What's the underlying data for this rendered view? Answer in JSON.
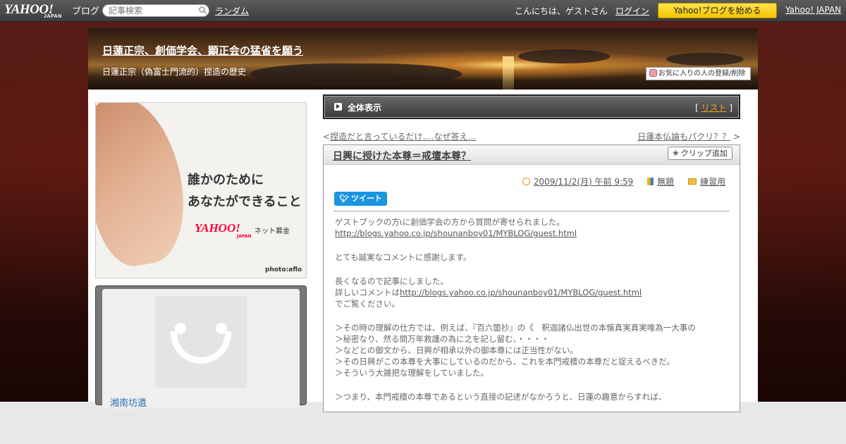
{
  "topbar": {
    "logo_main": "YAHOO!",
    "logo_sub": "JAPAN",
    "logo_blog": "ブログ",
    "search_placeholder": "記事検索",
    "random_label": "ランダム",
    "greeting": "こんにちは、ゲストさん",
    "login_label": "ログイン",
    "start_label": "Yahoo!ブログを始める",
    "yahoo_japan_label": "Yahoo! JAPAN"
  },
  "header": {
    "title": "日蓮正宗、創価学会、顕正会の猛省を願う",
    "description": "日蓮正宗（偽富士門流的）捏造の歴史",
    "fav_label": "お気に入りの人の登録/削除"
  },
  "ad": {
    "line1": "誰かのために",
    "line2": "あなたができること",
    "logo": "YAHOO!",
    "logo_sub": "JAPAN",
    "service": "ネット募金",
    "credit": "photo:aflo"
  },
  "profile": {
    "name": "湘南坊遺"
  },
  "listbar": {
    "all_label": "全体表示",
    "bracket_open": "[ ",
    "list_label": "リスト",
    "bracket_close": " ]"
  },
  "nav": {
    "prev_arrow": "<",
    "prev_label": "捏造だと言っているだけ‥‥なぜ答え…",
    "next_label": "日蓮本仏論もパクリ？？",
    "next_arrow": " >"
  },
  "article": {
    "title": "日興に授けた本尊＝戒壇本尊？",
    "clip_label": "クリップ追加",
    "date": "2009/11/2(月) 午前 9:59",
    "book": "無題",
    "category": "練習用",
    "tweet_label": "ツイート",
    "lines": [
      "ゲストブックの方ιに創価学会の方から質問が寄せられました。",
      "http://blogs.yahoo.co.jp/shounanboy01/MYBLOG/guest.html",
      "",
      "とても誠実なコメントに感謝します。",
      "",
      "長くなるので記事にしました。",
      "詳しいコメントは",
      "http://blogs.yahoo.co.jp/shounanboy01/MYBLOG/guest.html",
      "でご覧ください。",
      "",
      "＞その時の理解の仕方では、例えば、『百六箇抄』の《　釈迦諸仏出世の本懐真実真実唯為一大事の",
      "＞秘密なり、然る間万年救護の為に之を記し留む、・・・・",
      "＞などとの御文から、日興が相承以外の御本尊には正当性がない。",
      "＞その日興がこの本尊を大事にしているのだから、これを本門戒檀の本尊だと捉えるべきだ。",
      "＞そういう大雑把な理解をしていました。",
      "",
      "＞つまり、本門戒檀の本尊であるという直接の記述がなかろうと、日蓮の趣意からすれば、"
    ]
  }
}
